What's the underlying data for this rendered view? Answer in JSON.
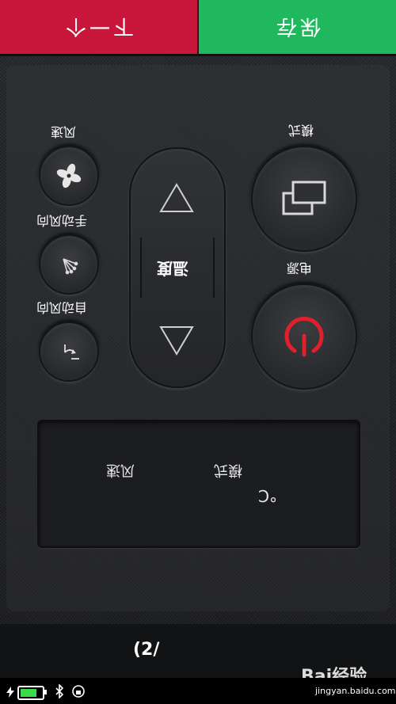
{
  "topbar": {
    "next_label": "下一个",
    "save_label": "保存"
  },
  "controls": {
    "fan_speed_label": "风速",
    "manual_direction_label": "手动风向",
    "auto_direction_label": "自动风向",
    "mode_label": "模式",
    "temperature_label": "温度",
    "power_label": "电源"
  },
  "display": {
    "fan_speed_text": "风速",
    "mode_text": "模式",
    "temperature_unit": "°C"
  },
  "pager": {
    "text": "(2/",
    "suffix": ""
  },
  "watermark": {
    "text": "Bai经验",
    "url": "jingyan.baidu.com"
  },
  "colors": {
    "next": "#c8173b",
    "save": "#1fb85c",
    "power_icon": "#e0202a"
  }
}
